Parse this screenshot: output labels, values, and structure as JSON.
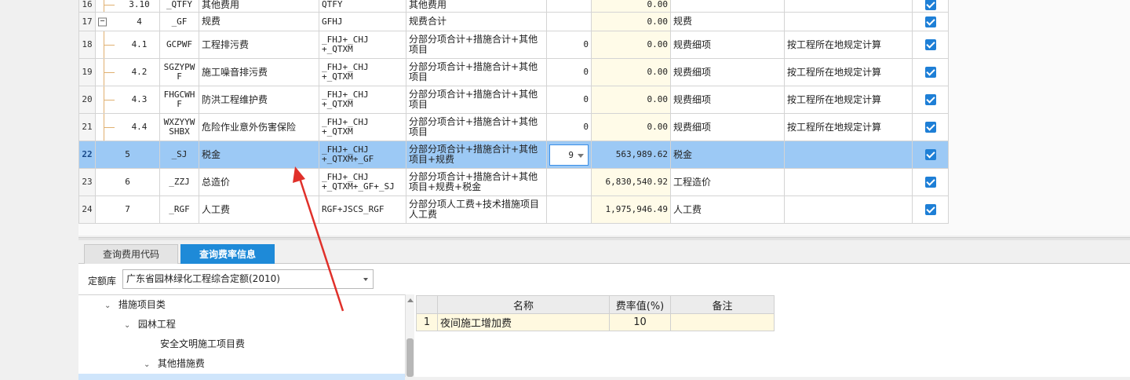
{
  "grid": {
    "rows": [
      {
        "num": "16",
        "seq": "3.10",
        "code": "_QTFY",
        "name": "其他费用",
        "base": "QTFY",
        "desc": "其他费用",
        "rate": "",
        "amount": "0.00",
        "type": "",
        "remark": "",
        "checked": true
      },
      {
        "num": "17",
        "seq": "4",
        "code": "_GF",
        "name": "规费",
        "base": "GFHJ",
        "desc": "规费合计",
        "rate": "",
        "amount": "0.00",
        "type": "规费",
        "remark": "",
        "checked": true
      },
      {
        "num": "18",
        "seq": "4.1",
        "code": "GCPWF",
        "name": "工程排污费",
        "base": "_FHJ+_CHJ +_QTXM",
        "desc": "分部分项合计+措施合计+其他项目",
        "rate": "0",
        "amount": "0.00",
        "type": "规费细项",
        "remark": "按工程所在地规定计算",
        "checked": true
      },
      {
        "num": "19",
        "seq": "4.2",
        "code": "SGZYPW F",
        "name": "施工噪音排污费",
        "base": "_FHJ+_CHJ +_QTXM",
        "desc": "分部分项合计+措施合计+其他项目",
        "rate": "0",
        "amount": "0.00",
        "type": "规费细项",
        "remark": "按工程所在地规定计算",
        "checked": true
      },
      {
        "num": "20",
        "seq": "4.3",
        "code": "FHGCWH F",
        "name": "防洪工程维护费",
        "base": "_FHJ+_CHJ +_QTXM",
        "desc": "分部分项合计+措施合计+其他项目",
        "rate": "0",
        "amount": "0.00",
        "type": "规费细项",
        "remark": "按工程所在地规定计算",
        "checked": true
      },
      {
        "num": "21",
        "seq": "4.4",
        "code": "WXZYYW SHBX",
        "name": "危险作业意外伤害保险",
        "base": "_FHJ+_CHJ +_QTXM",
        "desc": "分部分项合计+措施合计+其他项目",
        "rate": "0",
        "amount": "0.00",
        "type": "规费细项",
        "remark": "按工程所在地规定计算",
        "checked": true
      },
      {
        "num": "22",
        "seq": "5",
        "code": "_SJ",
        "name": "税金",
        "base": "_FHJ+_CHJ +_QTXM+_GF",
        "desc": "分部分项合计+措施合计+其他项目+规费",
        "rate": "9",
        "amount": "563,989.62",
        "type": "税金",
        "remark": "",
        "checked": true
      },
      {
        "num": "23",
        "seq": "6",
        "code": "_ZZJ",
        "name": "总造价",
        "base": "_FHJ+_CHJ +_QTXM+_GF+_SJ",
        "desc": "分部分项合计+措施合计+其他项目+规费+税金",
        "rate": "",
        "amount": "6,830,540.92",
        "type": "工程造价",
        "remark": "",
        "checked": true
      },
      {
        "num": "24",
        "seq": "7",
        "code": "_RGF",
        "name": "人工费",
        "base": "RGF+JSCS_RGF",
        "desc": "分部分项人工费+技术措施项目人工费",
        "rate": "",
        "amount": "1,975,946.49",
        "type": "人工费",
        "remark": "",
        "checked": true
      }
    ],
    "expander_symbol": "−"
  },
  "tabs": [
    {
      "label": "查询费用代码",
      "active": false
    },
    {
      "label": "查询费率信息",
      "active": true
    }
  ],
  "quota": {
    "label": "定额库",
    "value": "广东省园林绿化工程综合定额(2010)"
  },
  "tree": [
    {
      "label": "措施项目类",
      "arrow": "⌄"
    },
    {
      "label": "园林工程",
      "arrow": "⌄"
    },
    {
      "label": "安全文明施工项目费",
      "arrow": ""
    },
    {
      "label": "其他措施费",
      "arrow": "⌄"
    }
  ],
  "rate_table": {
    "headers": [
      "名称",
      "费率值(%)",
      "备注"
    ],
    "rows": [
      {
        "idx": "1",
        "name": "夜间施工增加费",
        "rate": "10",
        "note": ""
      }
    ]
  },
  "colors": {
    "selected_row": "#9cc9f5",
    "active_tab": "#1e8ad8",
    "checkbox": "#1e7fd6",
    "annotation_arrow": "#e0302a"
  }
}
